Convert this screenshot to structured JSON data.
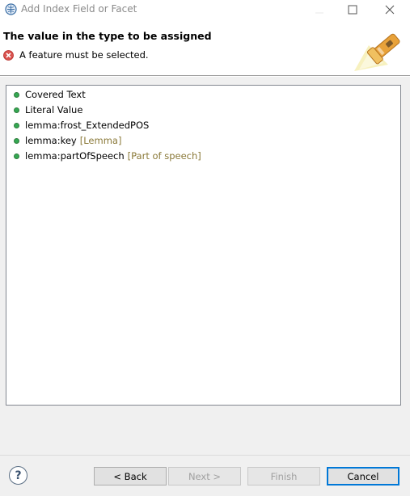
{
  "window": {
    "title": "Add Index Field or Facet",
    "controls": {
      "minimize": "minimize-icon",
      "maximize": "maximize-icon",
      "close": "close-icon"
    }
  },
  "banner": {
    "title": "The value in the type to be assigned",
    "message": "A feature must be selected.",
    "message_icon": "error-icon",
    "art_icon": "flashlight-icon"
  },
  "feature_list": {
    "items": [
      {
        "label": "Covered Text",
        "hint": ""
      },
      {
        "label": "Literal Value",
        "hint": ""
      },
      {
        "label": "lemma:frost_ExtendedPOS",
        "hint": ""
      },
      {
        "label": "lemma:key",
        "hint": "[Lemma]"
      },
      {
        "label": "lemma:partOfSpeech",
        "hint": "[Part of speech]"
      }
    ],
    "item_icon": "green-dot-icon"
  },
  "buttons": {
    "help": "?",
    "back": "< Back",
    "next": "Next >",
    "finish": "Finish",
    "cancel": "Cancel"
  },
  "colors": {
    "hint_text": "#8b7a3a",
    "dot": "#34a853",
    "error": "#d9534f",
    "default_button_border": "#0078d7"
  }
}
